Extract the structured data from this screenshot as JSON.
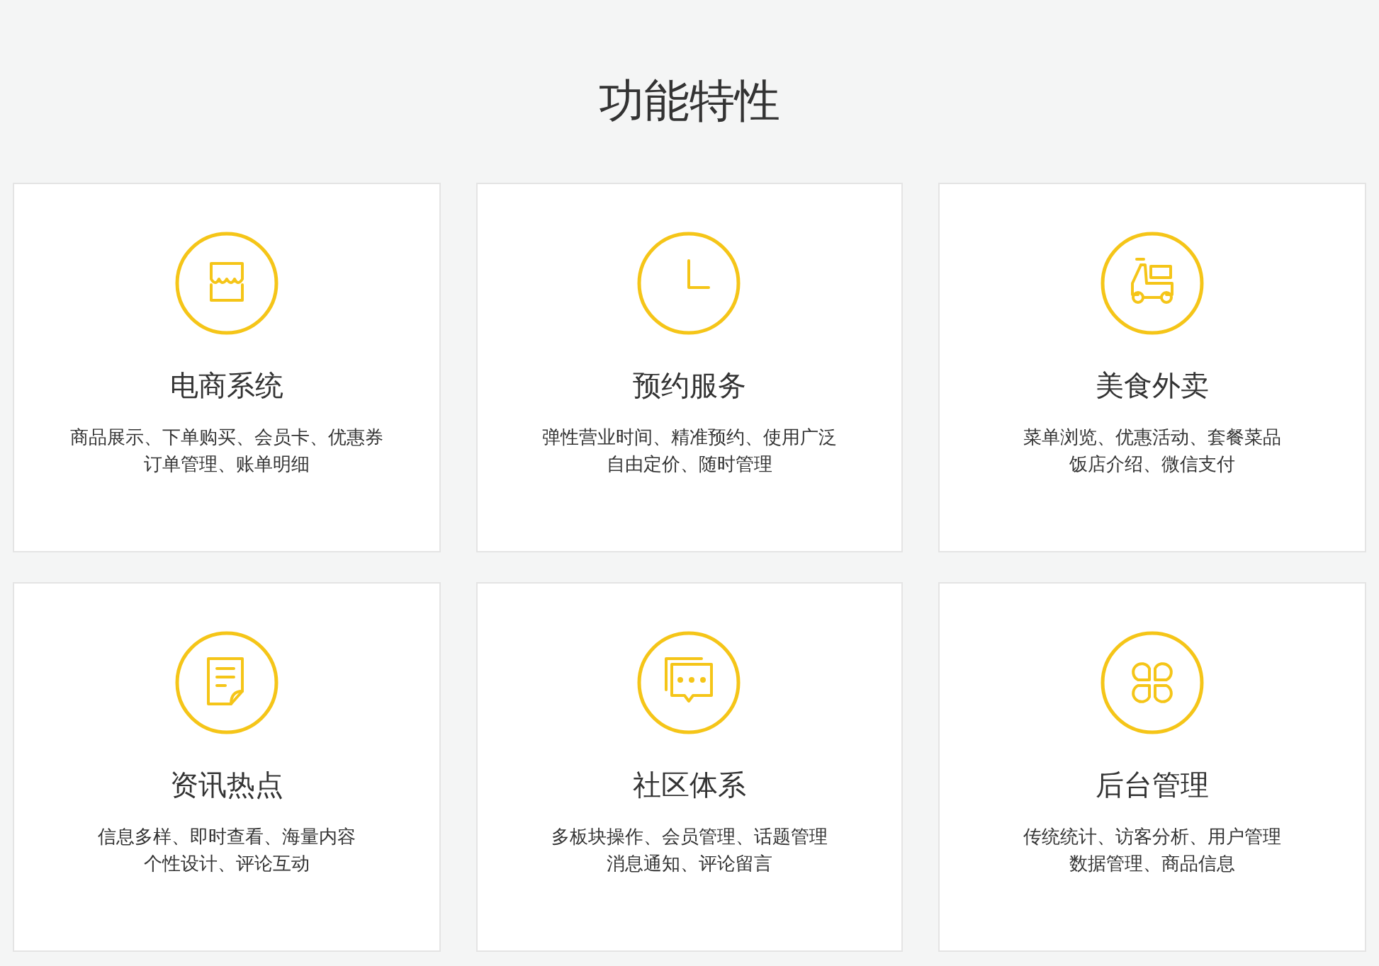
{
  "heading": "功能特性",
  "features": [
    {
      "title": "电商系统",
      "lines": [
        "商品展示、下单购买、会员卡、优惠券",
        "订单管理、账单明细"
      ]
    },
    {
      "title": "预约服务",
      "lines": [
        "弹性营业时间、精准预约、使用广泛",
        "自由定价、随时管理"
      ]
    },
    {
      "title": "美食外卖",
      "lines": [
        "菜单浏览、优惠活动、套餐菜品",
        "饭店介绍、微信支付"
      ]
    },
    {
      "title": "资讯热点",
      "lines": [
        "信息多样、即时查看、海量内容",
        "个性设计、评论互动"
      ]
    },
    {
      "title": "社区体系",
      "lines": [
        "多板块操作、会员管理、话题管理",
        "消息通知、评论留言"
      ]
    },
    {
      "title": "后台管理",
      "lines": [
        "传统统计、访客分析、用户管理",
        "数据管理、商品信息"
      ]
    }
  ]
}
